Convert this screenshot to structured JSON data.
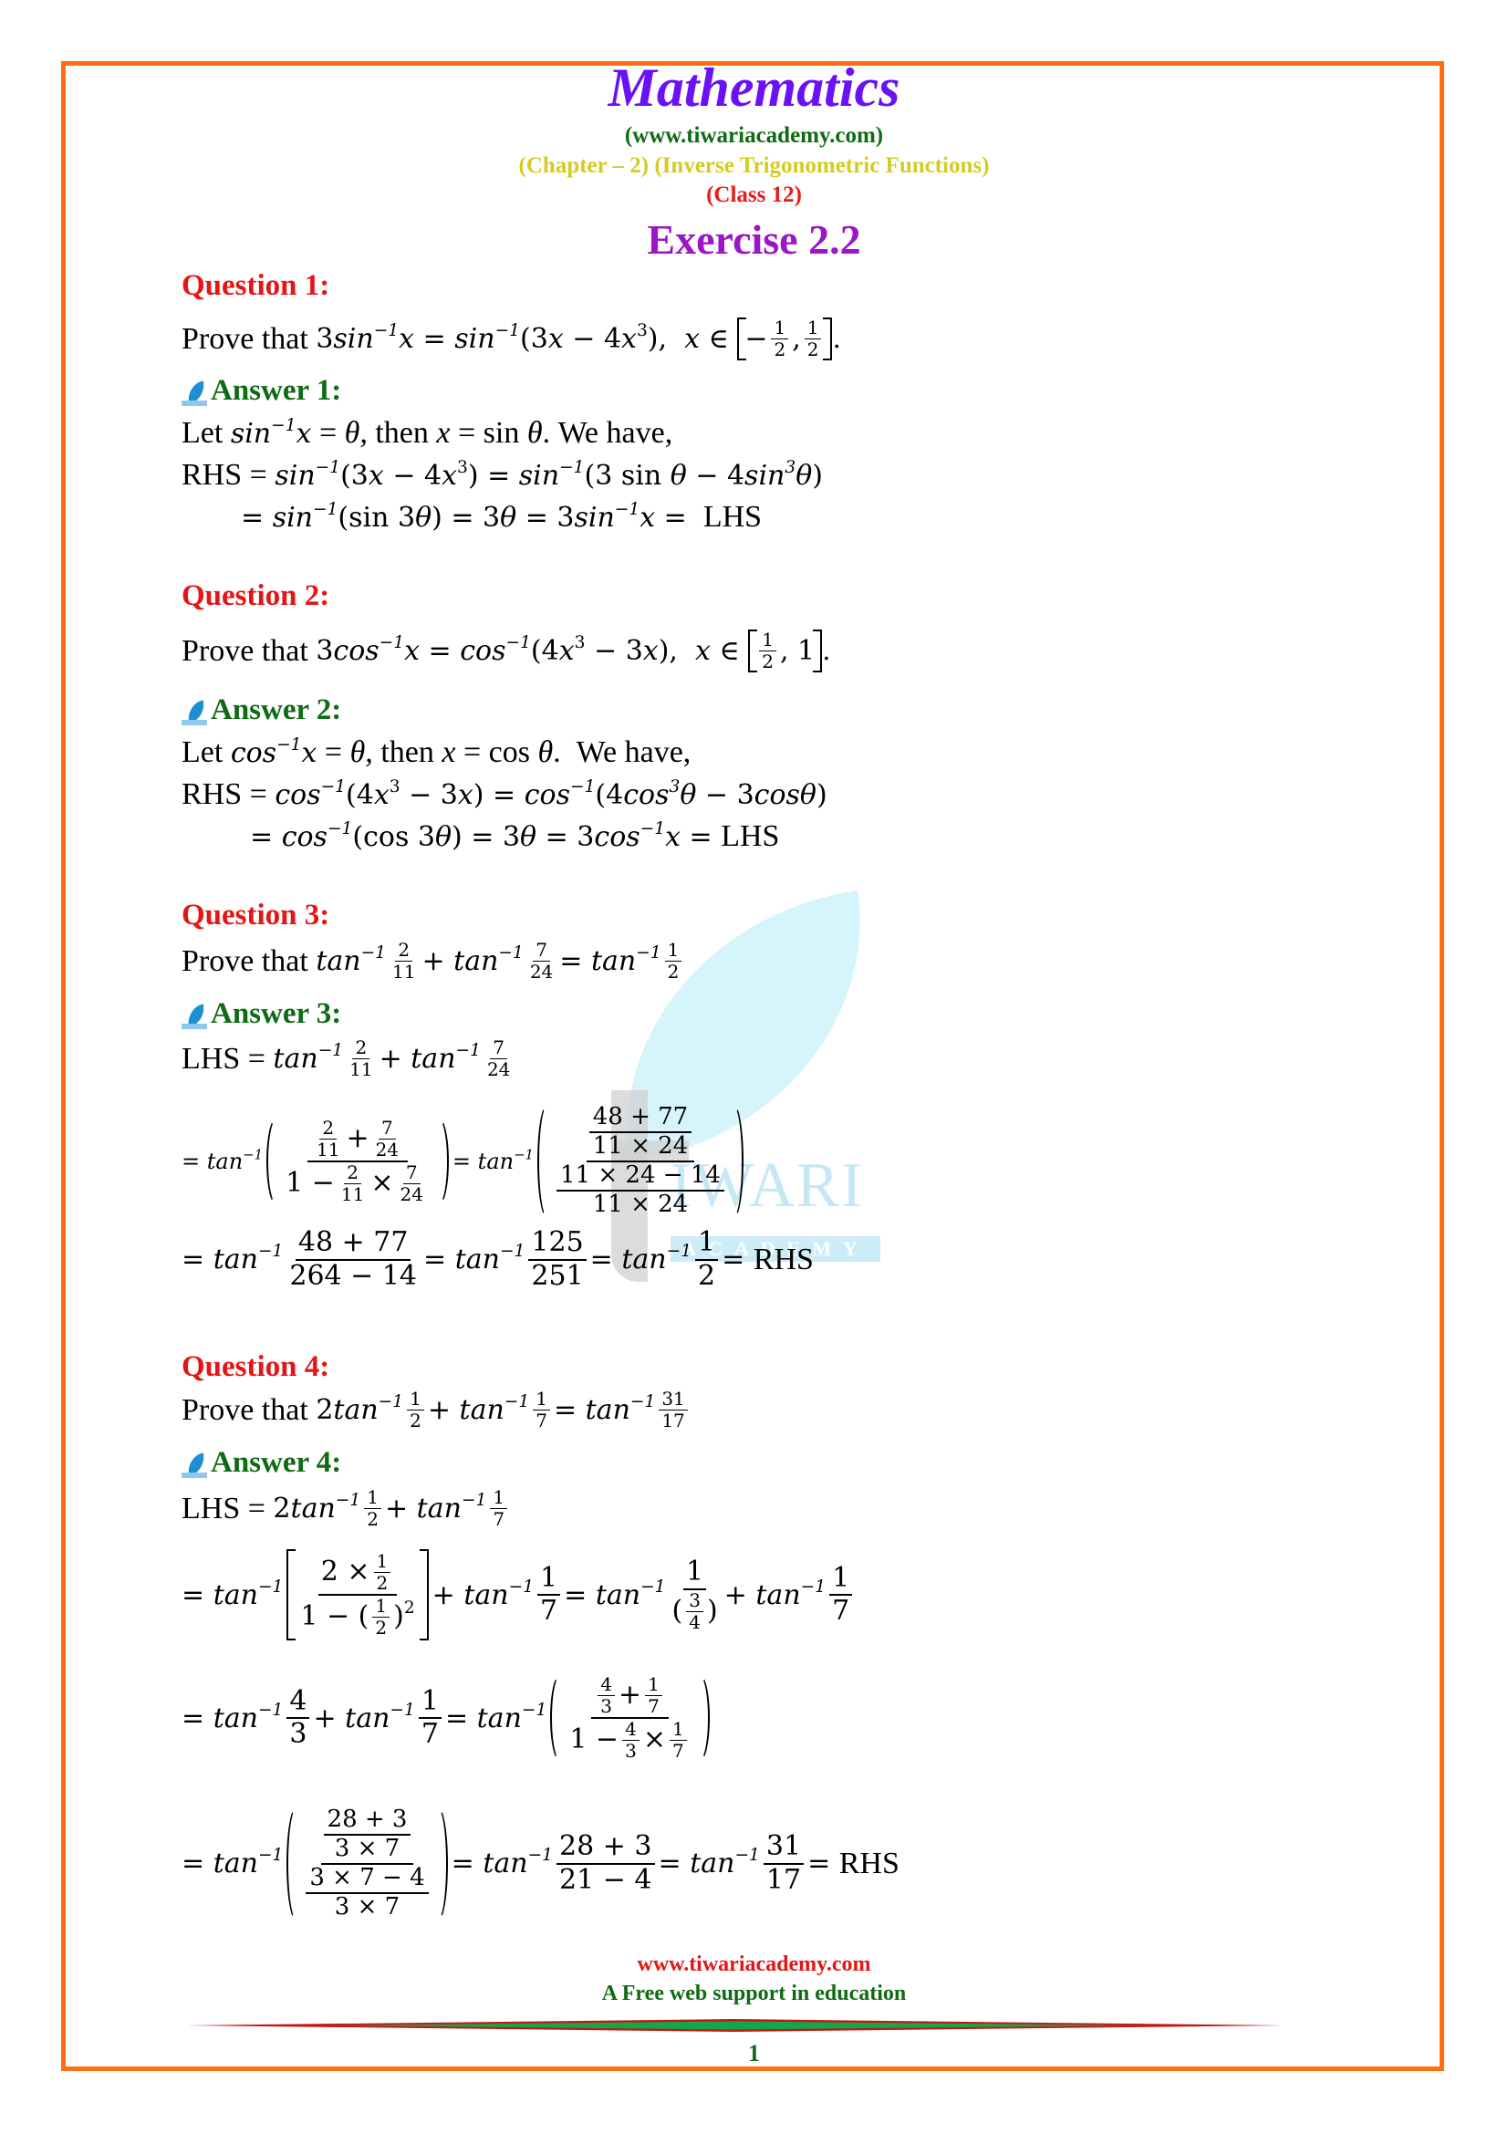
{
  "header": {
    "title": "Mathematics",
    "website": "(www.tiwariacademy.com)",
    "chapter": "(Chapter – 2) (Inverse Trigonometric Functions)",
    "class": "(Class 12)",
    "exercise": "Exercise 2.2"
  },
  "questions": [
    {
      "label": "Question 1:",
      "statement": "Prove that 3sin⁻¹x = sin⁻¹(3x − 4x³), x ∈ [−1/2, 1/2].",
      "answer_label": "Answer 1:",
      "answer_lines": [
        "Let sin⁻¹x = θ, then x = sin θ. We have,",
        "RHS = sin⁻¹(3x − 4x³) = sin⁻¹(3 sin θ − 4sin³θ)",
        "= sin⁻¹(sin 3θ) = 3θ = 3sin⁻¹x = LHS"
      ]
    },
    {
      "label": "Question 2:",
      "statement": "Prove that 3cos⁻¹x = cos⁻¹(4x³ − 3x), x ∈ [1/2, 1].",
      "answer_label": "Answer 2:",
      "answer_lines": [
        "Let cos⁻¹x = θ, then x = cos θ. We have,",
        "RHS = cos⁻¹(4x³ − 3x) = cos⁻¹(4cos³θ − 3cosθ)",
        "= cos⁻¹(cos 3θ) = 3θ = 3cos⁻¹x = LHS"
      ]
    },
    {
      "label": "Question 3:",
      "statement": "Prove that tan⁻¹(2/11) + tan⁻¹(7/24) = tan⁻¹(1/2)",
      "answer_label": "Answer 3:",
      "answer_lines": [
        "LHS = tan⁻¹(2/11) + tan⁻¹(7/24)",
        "= tan⁻¹((2/11 + 7/24)/(1 − 2/11 × 7/24)) = tan⁻¹(((48 + 77)/(11 × 24))/((11 × 24 − 14)/(11 × 24)))",
        "= tan⁻¹((48 + 77)/(264 − 14)) = tan⁻¹(125/251) = tan⁻¹(1/2) = RHS"
      ]
    },
    {
      "label": "Question 4:",
      "statement": "Prove that 2tan⁻¹(1/2) + tan⁻¹(1/7) = tan⁻¹(31/17)",
      "answer_label": "Answer 4:",
      "answer_lines": [
        "LHS = 2tan⁻¹(1/2) + tan⁻¹(1/7)",
        "= tan⁻¹[(2 × 1/2)/(1 − (1/2)²)] + tan⁻¹(1/7) = tan⁻¹(1/(3/4)) + tan⁻¹(1/7)",
        "= tan⁻¹(4/3) + tan⁻¹(1/7) = tan⁻¹((4/3 + 1/7)/(1 − 4/3 × 1/7))",
        "= tan⁻¹(((28 + 3)/(3 × 7))/((3 × 7 − 4)/(3 × 7))) = tan⁻¹((28 + 3)/(21 − 4)) = tan⁻¹(31/17) = RHS"
      ]
    }
  ],
  "tokens": {
    "prove_that": "Prove that",
    "let": "Let",
    "then": ", then",
    "we_have": "We have,",
    "rhs": "RHS",
    "lhs": "LHS",
    "eq": "=",
    "plus": "+",
    "minus": "−",
    "times": "×",
    "inv": "−1"
  },
  "watermark": {
    "name": "IWARI",
    "academy": "ACADEMY"
  },
  "footer": {
    "website": "www.tiwariacademy.com",
    "tagline": "A Free web support in education",
    "page_number": "1"
  },
  "colors": {
    "border": "#ff6f0f",
    "title": "#6a11f5",
    "website": "#0e6b12",
    "chapter": "#d4cc22",
    "class": "#e81a1a",
    "exercise": "#9b16c8",
    "question": "#e51515",
    "answer": "#0e6b12"
  }
}
